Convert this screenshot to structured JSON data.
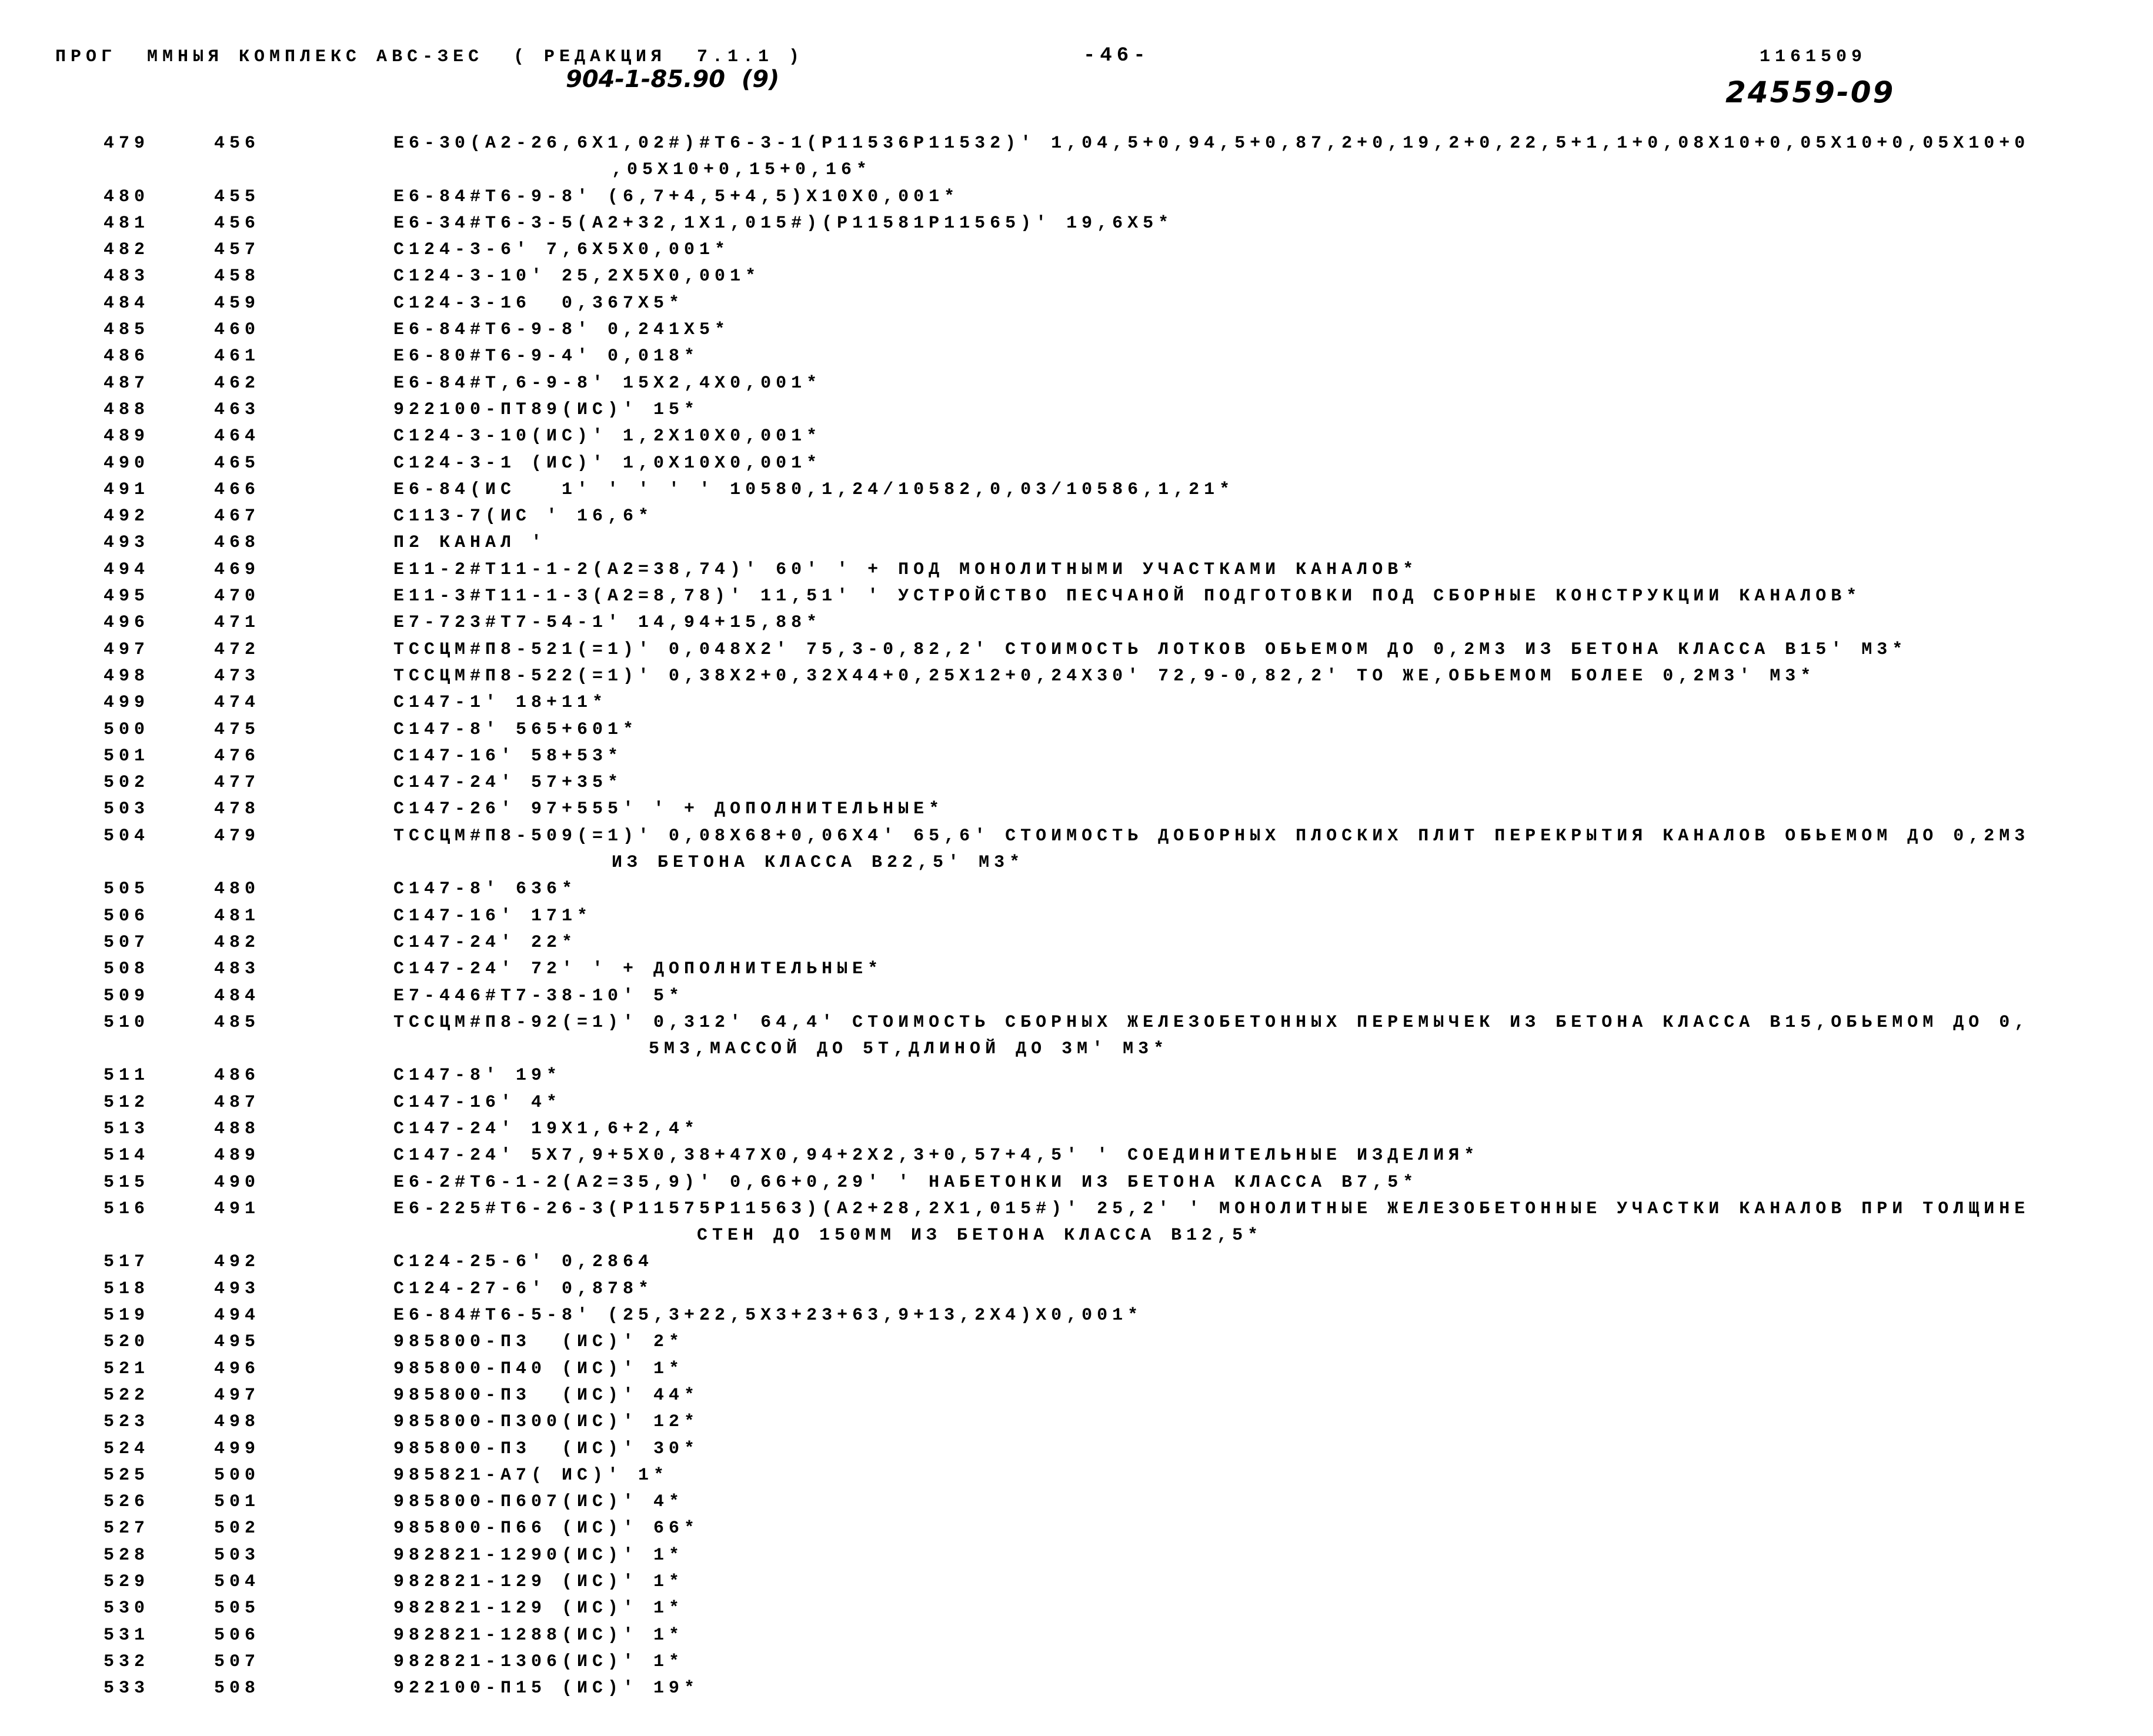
{
  "header": {
    "program": "ПРОГ  ММНЫЯ КОМПЛЕКС АВС-ЗЕС",
    "edition": "( РЕДАКЦИЯ  7.1.1 )",
    "page": "-46-",
    "code": "1161509",
    "handwritten_ref": "904-1-85.90  (9)",
    "handwritten_number": "24559-09"
  },
  "rows": [
    {
      "n1": "479",
      "n2": "456",
      "text": "E6-30(A2-26,6X1,02#)#T6-3-1(P11536P11532)' 1,04,5+0,94,5+0,87,2+0,19,2+0,22,5+1,1+0,08X10+0,05X10+0,05X10+0",
      "cont": ",05X10+0,15+0,16*"
    },
    {
      "n1": "480",
      "n2": "455",
      "text": "E6-84#T6-9-8' (6,7+4,5+4,5)X10X0,001*"
    },
    {
      "n1": "481",
      "n2": "456",
      "text": "E6-34#T6-3-5(A2+32,1X1,015#)(P11581P11565)' 19,6X5*"
    },
    {
      "n1": "482",
      "n2": "457",
      "text": "C124-3-6' 7,6X5X0,001*"
    },
    {
      "n1": "483",
      "n2": "458",
      "text": "C124-3-10' 25,2X5X0,001*"
    },
    {
      "n1": "484",
      "n2": "459",
      "text": "C124-3-16  0,367X5*"
    },
    {
      "n1": "485",
      "n2": "460",
      "text": "E6-84#T6-9-8' 0,241X5*"
    },
    {
      "n1": "486",
      "n2": "461",
      "text": "E6-80#T6-9-4' 0,018*"
    },
    {
      "n1": "487",
      "n2": "462",
      "text": "E6-84#T,6-9-8' 15X2,4X0,001*"
    },
    {
      "n1": "488",
      "n2": "463",
      "text": "922100-ПТ89(ИС)' 15*"
    },
    {
      "n1": "489",
      "n2": "464",
      "text": "C124-3-10(ИС)' 1,2X10X0,001*"
    },
    {
      "n1": "490",
      "n2": "465",
      "text": "C124-3-1 (ИС)' 1,0X10X0,001*"
    },
    {
      "n1": "491",
      "n2": "466",
      "text": "E6-84(ИС   1' ' ' ' ' 10580,1,24/10582,0,03/10586,1,21*"
    },
    {
      "n1": "492",
      "n2": "467",
      "text": "C113-7(ИС ' 16,6*"
    },
    {
      "n1": "493",
      "n2": "468",
      "text": "П2 КАНАЛ '"
    },
    {
      "n1": "494",
      "n2": "469",
      "text": "E11-2#T11-1-2(A2=38,74)' 60' ' + ПОД МОНОЛИТНЫМИ УЧАСТКАМИ КАНАЛОВ*"
    },
    {
      "n1": "495",
      "n2": "470",
      "text": "E11-3#T11-1-3(A2=8,78)' 11,51' ' УСТРОЙСТВО ПЕСЧАНОЙ ПОДГОТОВКИ ПОД СБОРНЫЕ КОНСТРУКЦИИ КАНАЛОВ*"
    },
    {
      "n1": "496",
      "n2": "471",
      "text": "E7-723#T7-54-1' 14,94+15,88*"
    },
    {
      "n1": "497",
      "n2": "472",
      "text": "TCCЦМ#П8-521(=1)' 0,048X2' 75,3-0,82,2' СТОИМОСТЬ ЛОТКОВ ОБЬЕМОМ ДО 0,2М3 ИЗ БЕТОНА КЛАССА В15' М3*"
    },
    {
      "n1": "498",
      "n2": "473",
      "text": "TCCЦМ#П8-522(=1)' 0,38X2+0,32X44+0,25X12+0,24X30' 72,9-0,82,2' ТО ЖЕ,ОБЬЕМОМ БОЛЕЕ 0,2М3' М3*"
    },
    {
      "n1": "499",
      "n2": "474",
      "text": "C147-1' 18+11*"
    },
    {
      "n1": "500",
      "n2": "475",
      "text": "C147-8' 565+601*"
    },
    {
      "n1": "501",
      "n2": "476",
      "text": "C147-16' 58+53*"
    },
    {
      "n1": "502",
      "n2": "477",
      "text": "C147-24' 57+35*"
    },
    {
      "n1": "503",
      "n2": "478",
      "text": "C147-26' 97+555' ' + ДОПОЛНИТЕЛЬНЫЕ*"
    },
    {
      "n1": "504",
      "n2": "479",
      "text": "TCCЦМ#П8-509(=1)' 0,08X68+0,06X4' 65,6' СТОИМОСТЬ ДОБОРНЫХ ПЛОСКИХ ПЛИТ ПЕРЕКРЫТИЯ КАНАЛОВ ОБЬЕМОМ ДО 0,2М3",
      "cont": "ИЗ БЕТОНА КЛАССА В22,5' М3*"
    },
    {
      "n1": "505",
      "n2": "480",
      "text": "C147-8' 636*"
    },
    {
      "n1": "506",
      "n2": "481",
      "text": "C147-16' 171*"
    },
    {
      "n1": "507",
      "n2": "482",
      "text": "C147-24' 22*"
    },
    {
      "n1": "508",
      "n2": "483",
      "text": "C147-24' 72' ' + ДОПОЛНИТЕЛЬНЫЕ*"
    },
    {
      "n1": "509",
      "n2": "484",
      "text": "E7-446#T7-38-10' 5*"
    },
    {
      "n1": "510",
      "n2": "485",
      "text": "TCCЦМ#П8-92(=1)' 0,312' 64,4' СТОИМОСТЬ СБОРНЫХ ЖЕЛЕЗОБЕТОННЫХ ПЕРЕМЫЧЕК ИЗ БЕТОНА КЛАССА В15,ОБЬЕМОМ ДО 0,",
      "cont": "5М3,МАССОЙ ДО 5Т,ДЛИНОЙ ДО 3М' М3*"
    },
    {
      "n1": "511",
      "n2": "486",
      "text": "C147-8' 19*"
    },
    {
      "n1": "512",
      "n2": "487",
      "text": "C147-16' 4*"
    },
    {
      "n1": "513",
      "n2": "488",
      "text": "C147-24' 19X1,6+2,4*"
    },
    {
      "n1": "514",
      "n2": "489",
      "text": "C147-24' 5X7,9+5X0,38+47X0,94+2X2,3+0,57+4,5' ' СОЕДИНИТЕЛЬНЫЕ ИЗДЕЛИЯ*"
    },
    {
      "n1": "515",
      "n2": "490",
      "text": "E6-2#T6-1-2(A2=35,9)' 0,66+0,29' ' НАБЕТОНКИ ИЗ БЕТОНА КЛАССА В7,5*"
    },
    {
      "n1": "516",
      "n2": "491",
      "text": "E6-225#T6-26-3(P11575P11563)(A2+28,2X1,015#)' 25,2' ' МОНОЛИТНЫЕ ЖЕЛЕЗОБЕТОННЫЕ УЧАСТКИ КАНАЛОВ ПРИ ТОЛЩИНЕ",
      "cont": "СТЕН ДО 150ММ ИЗ БЕТОНА КЛАССА В12,5*"
    },
    {
      "n1": "517",
      "n2": "492",
      "text": "C124-25-6' 0,2864"
    },
    {
      "n1": "518",
      "n2": "493",
      "text": "C124-27-6' 0,878*"
    },
    {
      "n1": "519",
      "n2": "494",
      "text": "E6-84#T6-5-8' (25,3+22,5X3+23+63,9+13,2X4)X0,001*"
    },
    {
      "n1": "520",
      "n2": "495",
      "text": "985800-П3  (ИС)' 2*"
    },
    {
      "n1": "521",
      "n2": "496",
      "text": "985800-П40 (ИС)' 1*"
    },
    {
      "n1": "522",
      "n2": "497",
      "text": "985800-П3  (ИС)' 44*"
    },
    {
      "n1": "523",
      "n2": "498",
      "text": "985800-П300(ИС)' 12*"
    },
    {
      "n1": "524",
      "n2": "499",
      "text": "985800-П3  (ИС)' 30*"
    },
    {
      "n1": "525",
      "n2": "500",
      "text": "985821-А7( ИС)' 1*"
    },
    {
      "n1": "526",
      "n2": "501",
      "text": "985800-П607(ИС)' 4*"
    },
    {
      "n1": "527",
      "n2": "502",
      "text": "985800-П66 (ИС)' 66*"
    },
    {
      "n1": "528",
      "n2": "503",
      "text": "982821-1290(ИС)' 1*"
    },
    {
      "n1": "529",
      "n2": "504",
      "text": "982821-129 (ИС)' 1*"
    },
    {
      "n1": "530",
      "n2": "505",
      "text": "982821-129 (ИС)' 1*"
    },
    {
      "n1": "531",
      "n2": "506",
      "text": "982821-1288(ИС)' 1*"
    },
    {
      "n1": "532",
      "n2": "507",
      "text": "982821-1306(ИС)' 1*"
    },
    {
      "n1": "533",
      "n2": "508",
      "text": "922100-П15 (ИС)' 19*"
    }
  ]
}
